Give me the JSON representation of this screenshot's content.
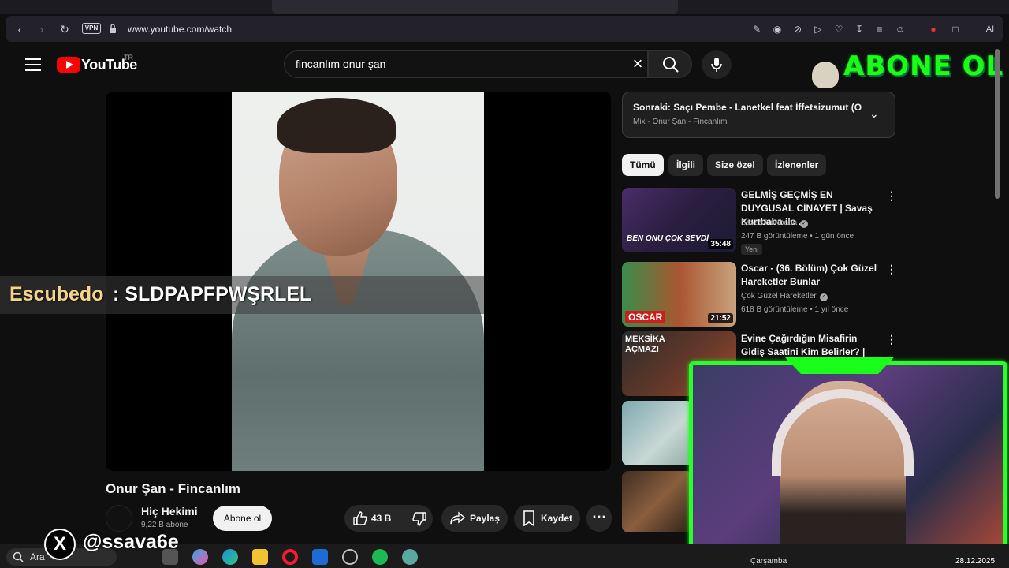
{
  "browser": {
    "url": "www.youtube.com/watch",
    "vpn_label": "VPN",
    "ai_label": "AI"
  },
  "youtube": {
    "logo_text": "YouTube",
    "region": "TR",
    "search_query": "fincanlım onur şan"
  },
  "overlay": {
    "abone_text": "ABONE OL",
    "chat_user": "Escubedo",
    "chat_message": ": SLDPAPFPWŞRLEL",
    "x_handle": "@ssava6e"
  },
  "video": {
    "title": "Onur Şan - Fincanlım",
    "channel": "Hiç Hekimi",
    "subscribers": "9,22 B abone",
    "subscribe_label": "Abone ol",
    "likes": "43 B",
    "share_label": "Paylaş",
    "save_label": "Kaydet"
  },
  "up_next": {
    "title": "Sonraki: Saçı Pembe - Lanetkel feat İffetsizumut (O...",
    "subtitle": "Mix - Onur Şan - Fincanlım"
  },
  "chips": [
    "Tümü",
    "İlgili",
    "Size özel",
    "İzlenenler"
  ],
  "recommendations": [
    {
      "title": "GELMİŞ GEÇMİŞ EN DUYGUSAL CİNAYET | Savaş Kurtbaba ile ...",
      "channel": "Savaş Kurtbaba",
      "meta": "247 B görüntüleme • 1 gün önce",
      "badge": "Yeni",
      "duration": "35:48",
      "thumb_text": "BEN ONU ÇOK SEVDİ"
    },
    {
      "title": "Oscar - (36. Bölüm) Çok Güzel Hareketler Bunlar",
      "channel": "Çok Güzel Hareketler",
      "meta": "618 B görüntüleme • 1 yıl önce",
      "duration": "21:52",
      "thumb_text": "OSCAR"
    },
    {
      "title": "Evine Çağırdığın Misafirin Gidiş Saatini Kim Belirler? | Meksika...",
      "thumb_text": "MEKSİKA AÇMAZI"
    }
  ],
  "taskbar": {
    "search_label": "Ara",
    "day": "Çarşamba",
    "date": "28.12.2025"
  }
}
